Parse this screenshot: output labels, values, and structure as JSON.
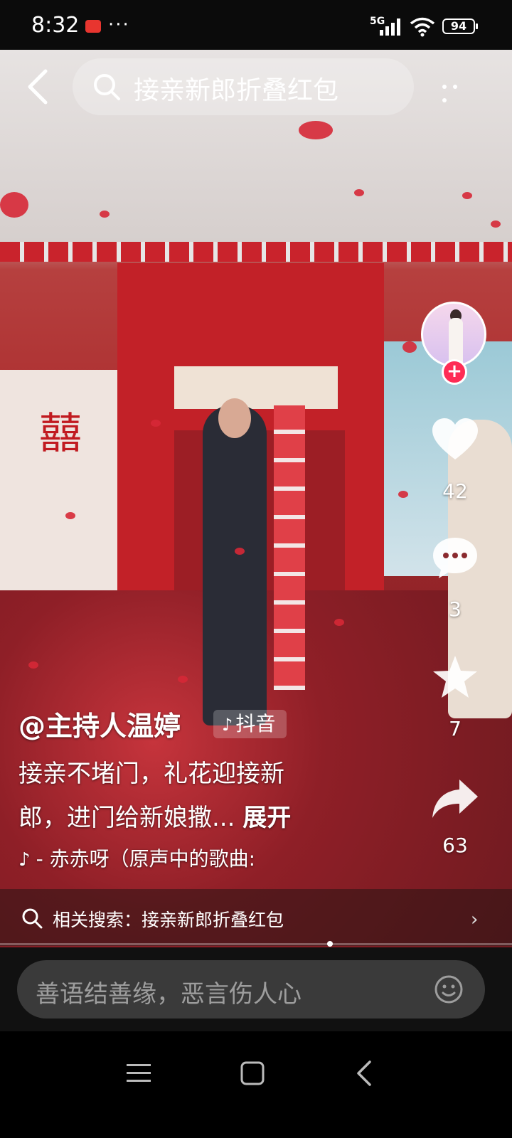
{
  "status_bar": {
    "time": "8:32",
    "dots": "···",
    "network": "5G",
    "battery": "94"
  },
  "top_bar": {
    "search_query": "接亲新郎折叠红包"
  },
  "rail": {
    "likes": "42",
    "comments": "3",
    "favorites": "7",
    "shares": "63",
    "accent_color": "#fe2c55"
  },
  "caption": {
    "author": "@主持人温婷",
    "badge": "抖音",
    "line1": "接亲不堵门，礼花迎接新",
    "line2": "郎，进门给新娘撒...",
    "expand": "展开",
    "music": "- 赤赤呀（原声中的歌曲:"
  },
  "related": {
    "label": "相关搜索：",
    "query": "接亲新郎折叠红包"
  },
  "comment": {
    "placeholder": "善语结善缘，恶言伤人心"
  },
  "icons": {
    "back": "chevron-left-icon",
    "search": "search-icon",
    "more": "more-dots-icon",
    "like": "heart-icon",
    "comment": "comment-bubble-icon",
    "favorite": "star-icon",
    "share": "share-arrow-icon",
    "emoji": "emoji-icon",
    "nav_menu": "menu-lines-icon",
    "nav_home": "square-home-icon",
    "nav_back": "triangle-back-icon"
  }
}
